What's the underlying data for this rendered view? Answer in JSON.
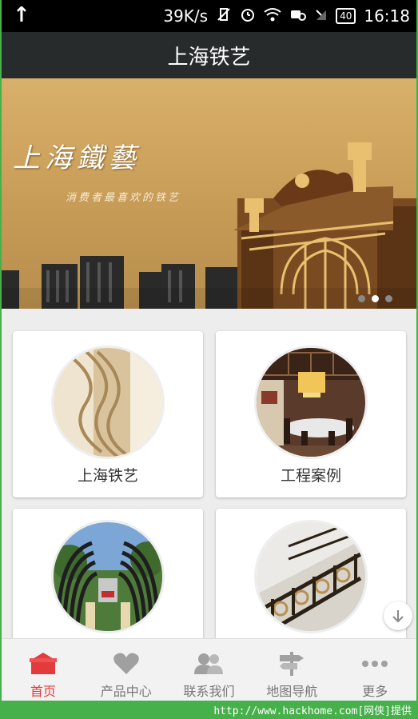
{
  "status_bar": {
    "network_speed": "39K/s",
    "battery": "40",
    "time": "16:18"
  },
  "app_title": "上海铁艺",
  "banner": {
    "title": "上海鐵藝",
    "subtitle": "消费者最喜欢的铁艺"
  },
  "cards": [
    {
      "label": "上海铁艺"
    },
    {
      "label": "工程案例"
    },
    {
      "label": ""
    },
    {
      "label": ""
    }
  ],
  "tabs": [
    {
      "label": "首页",
      "icon": "home-icon"
    },
    {
      "label": "产品中心",
      "icon": "heart-icon"
    },
    {
      "label": "联系我们",
      "icon": "contacts-icon"
    },
    {
      "label": "地图导航",
      "icon": "map-signpost-icon"
    },
    {
      "label": "更多",
      "icon": "more-dots-icon"
    }
  ],
  "footer": {
    "text": "http://www.hackhome.com[网侠]提供"
  },
  "colors": {
    "active_tab": "#E23B3B",
    "titlebar": "#272B2C",
    "frame_border": "#46B04A"
  }
}
